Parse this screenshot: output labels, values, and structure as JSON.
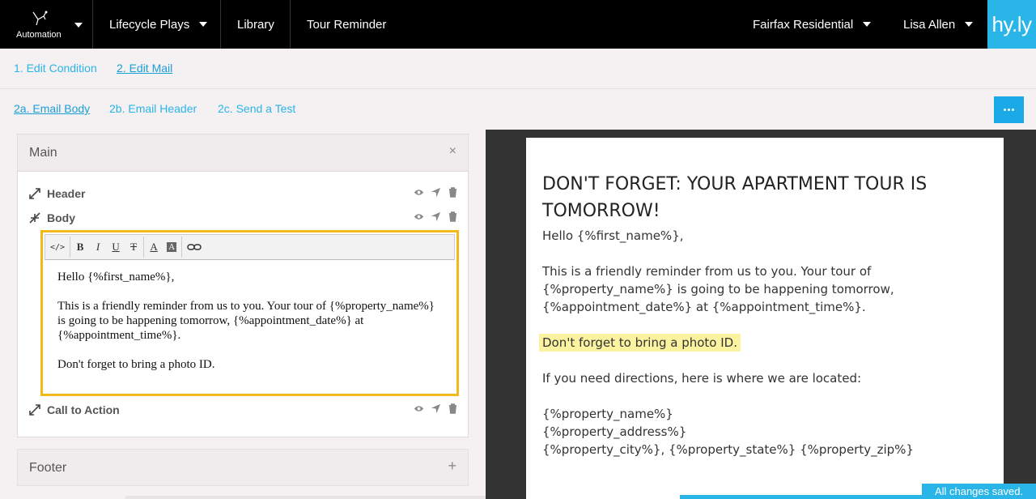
{
  "nav": {
    "automation_label": "Automation",
    "lifecycle_label": "Lifecycle Plays",
    "library_label": "Library",
    "tour_reminder_label": "Tour Reminder",
    "property_label": "Fairfax Residential",
    "user_label": "Lisa Allen",
    "logo_text": "hy.ly"
  },
  "steps": {
    "edit_condition": "1. Edit Condition",
    "edit_mail": "2. Edit Mail"
  },
  "substeps": {
    "email_body": "2a. Email Body",
    "email_header": "2b. Email Header",
    "send_test": "2c. Send a Test"
  },
  "editor_panel": {
    "main_title": "Main",
    "close_symbol": "×",
    "header_label": "Header",
    "body_label": "Body",
    "cta_label": "Call to Action",
    "footer_title": "Footer",
    "plus_symbol": "+"
  },
  "toolbar": {
    "code": "</>",
    "bold": "B",
    "italic": "I",
    "underline": "U",
    "strike": "T",
    "font_color": "A",
    "bg_color": "A"
  },
  "editor_content": {
    "p1": "Hello {%first_name%},",
    "p2": "This is a friendly reminder from us to you. Your tour of {%property_name%} is going to be happening tomorrow, {%appointment_date%} at {%appointment_time%}.",
    "p3": "Don't forget to bring a photo ID."
  },
  "preview": {
    "title": "DON'T FORGET: YOUR APARTMENT TOUR IS TOMORROW!",
    "greeting": "Hello {%first_name%},",
    "paragraph": "This is a friendly reminder from us to you. Your tour of {%property_name%} is going to be happening tomorrow, {%appointment_date%} at {%appointment_time%}.",
    "highlight": "Don't forget to bring a photo ID.",
    "directions": "If you need directions, here is where we are located:",
    "address_line1": "{%property_name%}",
    "address_line2": "{%property_address%}",
    "address_line3": "{%property_city%}, {%property_state%} {%property_zip%}"
  },
  "status": {
    "saved": "All changes saved."
  },
  "colors": {
    "accent": "#29b5e8",
    "editor_border": "#f2b919",
    "highlight": "#fbf3a0"
  }
}
